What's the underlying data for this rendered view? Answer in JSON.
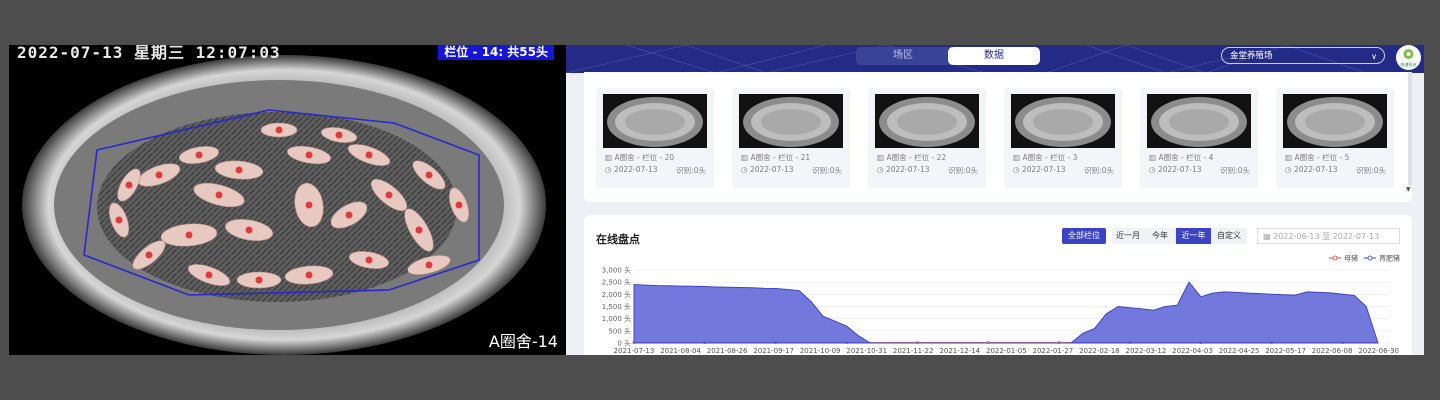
{
  "camera": {
    "timestamp": "2022-07-13 星期三 12:07:03",
    "pen_label": "栏位 - 14: 共55头",
    "house_label": "A圈舍-14"
  },
  "header": {
    "tabs": [
      {
        "label": "场区",
        "active": false
      },
      {
        "label": "数据",
        "active": true
      }
    ],
    "farm_select": "金堂养殖场",
    "logo_text": "唯谱科技"
  },
  "pens": [
    {
      "name": "A圈舍 - 栏位 - 20",
      "date": "2022-07-13",
      "count": "识别:0头"
    },
    {
      "name": "A圈舍 - 栏位 - 21",
      "date": "2022-07-13",
      "count": "识别:0头"
    },
    {
      "name": "A圈舍 - 栏位 - 22",
      "date": "2022-07-13",
      "count": "识别:0头"
    },
    {
      "name": "A圈舍 - 栏位 - 3",
      "date": "2022-07-13",
      "count": "识别:0头"
    },
    {
      "name": "A圈舍 - 栏位 - 4",
      "date": "2022-07-13",
      "count": "识别:0头"
    },
    {
      "name": "A圈舍 - 栏位 - 5",
      "date": "2022-07-13",
      "count": "识别:0头"
    }
  ],
  "inventory": {
    "title": "在线盘点",
    "all_pens_button": "全部栏位",
    "ranges": [
      {
        "label": "近一月",
        "active": false
      },
      {
        "label": "今年",
        "active": false
      },
      {
        "label": "近一年",
        "active": true
      },
      {
        "label": "自定义",
        "active": false
      }
    ],
    "date_range": "2022-06-13 至 2022-07-13"
  },
  "chart_data": {
    "type": "area",
    "series": [
      {
        "name": "母猪",
        "color": "#e0453a",
        "values": [
          0,
          0,
          0,
          0,
          0,
          0,
          0,
          0,
          0,
          0,
          0,
          0,
          0,
          0,
          0,
          0,
          0,
          0,
          0,
          0,
          0,
          0,
          0,
          0,
          0,
          0,
          0,
          0,
          0,
          0,
          0,
          0,
          0,
          0,
          0,
          0,
          0,
          0,
          0,
          0,
          0,
          0,
          0,
          0,
          0,
          0,
          0,
          0,
          0,
          0,
          0,
          0,
          0,
          0,
          0,
          0,
          0,
          0,
          0,
          0,
          0,
          0,
          0,
          0
        ]
      },
      {
        "name": "育肥猪",
        "color": "#3b45c4",
        "values": [
          2400,
          2380,
          2360,
          2350,
          2340,
          2330,
          2320,
          2300,
          2290,
          2280,
          2270,
          2250,
          2240,
          2200,
          2150,
          1700,
          1100,
          900,
          700,
          300,
          0,
          0,
          0,
          0,
          0,
          0,
          0,
          0,
          0,
          0,
          0,
          0,
          0,
          0,
          0,
          0,
          0,
          0,
          400,
          600,
          1200,
          1500,
          1450,
          1400,
          1350,
          1500,
          1550,
          2500,
          1900,
          2050,
          2100,
          2080,
          2050,
          2030,
          2000,
          1980,
          1970,
          2100,
          2080,
          2060,
          2000,
          1950,
          1500,
          0
        ]
      }
    ],
    "x_ticks": [
      "2021-07-13",
      "2021-08-04",
      "2021-08-26",
      "2021-09-17",
      "2021-10-09",
      "2021-10-31",
      "2021-11-22",
      "2021-12-14",
      "2022-01-05",
      "2022-01-27",
      "2022-02-18",
      "2022-03-12",
      "2022-04-03",
      "2022-04-25",
      "2022-05-17",
      "2022-06-08",
      "2022-06-30"
    ],
    "y_ticks": [
      "3,000 头",
      "2,500 头",
      "2,000 头",
      "1,500 头",
      "1,000 头",
      "500 头",
      "0 头"
    ],
    "ylim": [
      0,
      3000
    ],
    "grid": true,
    "legend_position": "top-right"
  },
  "colors": {
    "accent": "#3b45c4",
    "header_bg": "#232b86",
    "sow": "#e0453a",
    "finisher": "#3b45c4"
  }
}
